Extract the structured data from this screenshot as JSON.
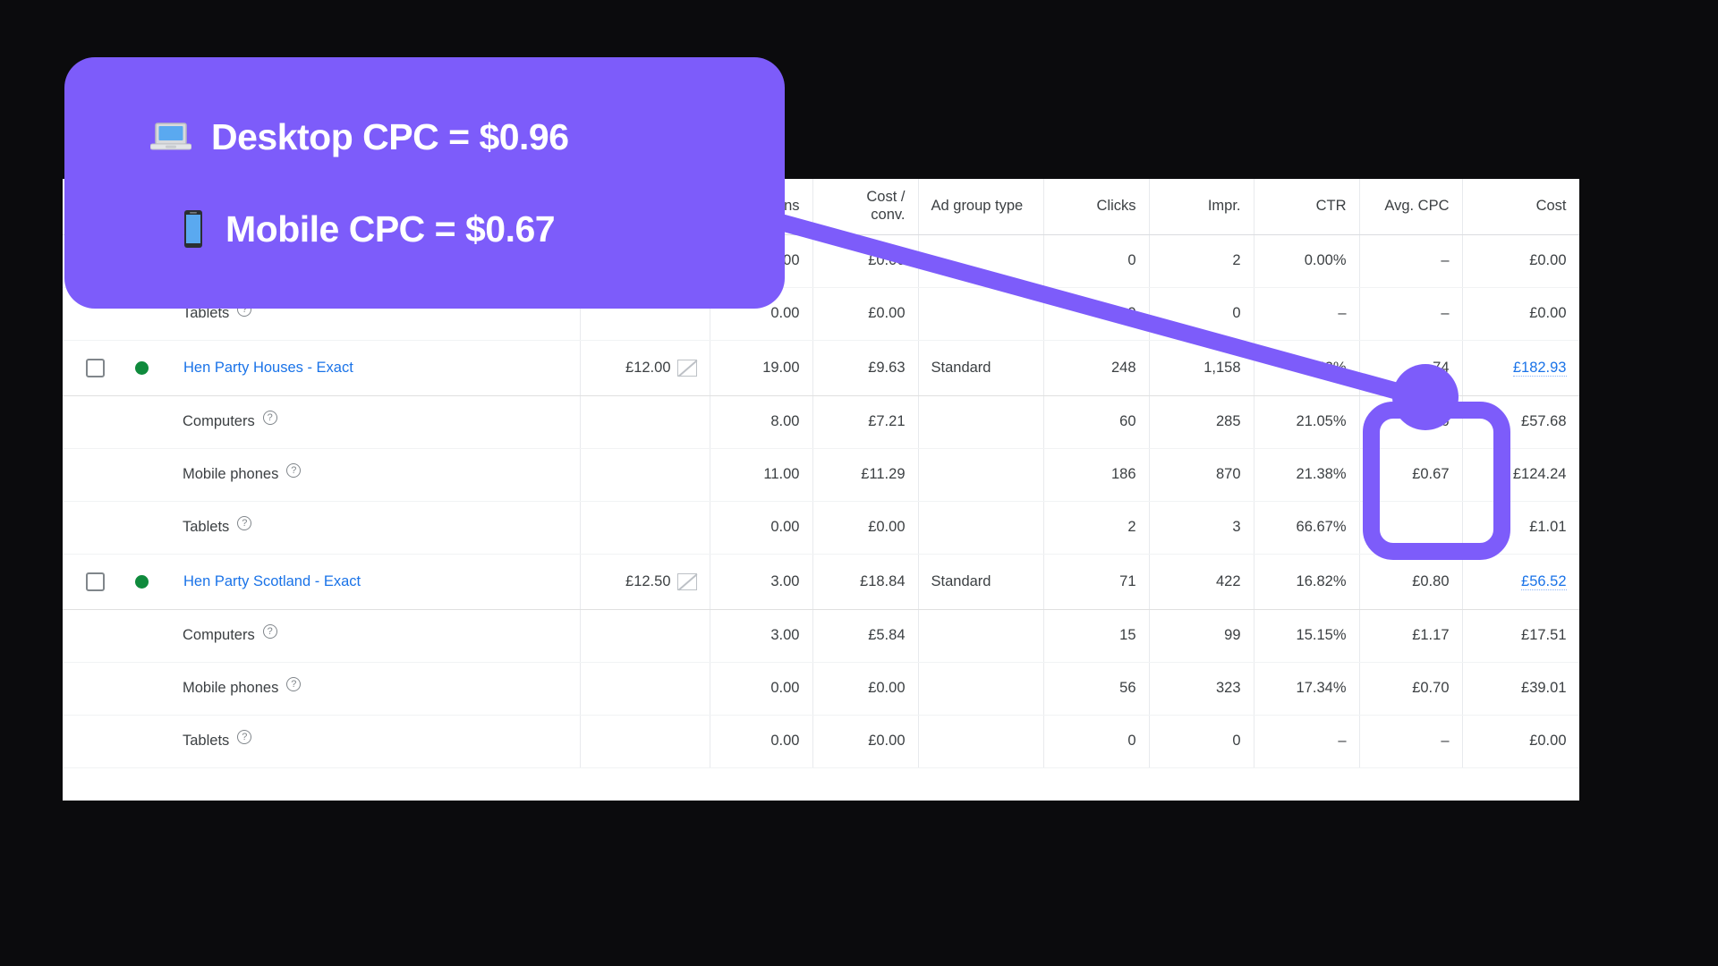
{
  "callout": {
    "lines": [
      {
        "icon": "laptop-icon",
        "glyph": "💻",
        "text": "Desktop CPC = $0.96"
      },
      {
        "icon": "mobile-phone-icon",
        "glyph": "📱",
        "text": "Mobile CPC = $0.67"
      }
    ],
    "accent_color": "#7d5cfa",
    "highlighted_values": [
      "£0.96",
      "£0.67"
    ]
  },
  "table": {
    "columns": [
      {
        "key": "name",
        "label": ""
      },
      {
        "key": "bid",
        "label": ""
      },
      {
        "key": "conv",
        "label": "ons"
      },
      {
        "key": "cost_conv",
        "label": "Cost /\nconv."
      },
      {
        "key": "ad_group_type",
        "label": "Ad group type"
      },
      {
        "key": "clicks",
        "label": "Clicks"
      },
      {
        "key": "impr",
        "label": "Impr."
      },
      {
        "key": "ctr",
        "label": "CTR"
      },
      {
        "key": "avg_cpc",
        "label": "Avg. CPC"
      },
      {
        "key": "cost",
        "label": "Cost"
      }
    ],
    "header": {
      "conv": "ons",
      "cost_conv_l1": "Cost /",
      "cost_conv_l2": "conv.",
      "ad_group_type": "Ad group type",
      "clicks": "Clicks",
      "impr": "Impr.",
      "ctr": "CTR",
      "avg_cpc": "Avg. CPC",
      "cost": "Cost"
    },
    "rows": [
      {
        "type": "sub",
        "device": "",
        "conv": ".00",
        "cost_conv": "£0.00",
        "ad_group_type": "",
        "clicks": "0",
        "impr": "2",
        "ctr": "0.00%",
        "avg_cpc": "–",
        "cost": "£0.00"
      },
      {
        "type": "sub",
        "device": "Tablets",
        "conv": "0.00",
        "cost_conv": "£0.00",
        "ad_group_type": "",
        "clicks": "0",
        "impr": "0",
        "ctr": "–",
        "avg_cpc": "–",
        "cost": "£0.00"
      },
      {
        "type": "group",
        "name": "Hen Party Houses - Exact",
        "bid": "£12.00",
        "conv": "19.00",
        "cost_conv": "£9.63",
        "ad_group_type": "Standard",
        "clicks": "248",
        "impr": "1,158",
        "ctr": "21.42%",
        "avg_cpc": "74",
        "cost": "£182.93",
        "cost_is_link": true
      },
      {
        "type": "sub",
        "device": "Computers",
        "conv": "8.00",
        "cost_conv": "£7.21",
        "ad_group_type": "",
        "clicks": "60",
        "impr": "285",
        "ctr": "21.05%",
        "avg_cpc": "£0.96",
        "cost": "£57.68"
      },
      {
        "type": "sub",
        "device": "Mobile phones",
        "conv": "11.00",
        "cost_conv": "£11.29",
        "ad_group_type": "",
        "clicks": "186",
        "impr": "870",
        "ctr": "21.38%",
        "avg_cpc": "£0.67",
        "cost": "£124.24"
      },
      {
        "type": "sub",
        "device": "Tablets",
        "conv": "0.00",
        "cost_conv": "£0.00",
        "ad_group_type": "",
        "clicks": "2",
        "impr": "3",
        "ctr": "66.67%",
        "avg_cpc": "",
        "cost": "£1.01"
      },
      {
        "type": "group",
        "name": "Hen Party Scotland - Exact",
        "bid": "£12.50",
        "conv": "3.00",
        "cost_conv": "£18.84",
        "ad_group_type": "Standard",
        "clicks": "71",
        "impr": "422",
        "ctr": "16.82%",
        "avg_cpc": "£0.80",
        "cost": "£56.52",
        "cost_is_link": true
      },
      {
        "type": "sub",
        "device": "Computers",
        "conv": "3.00",
        "cost_conv": "£5.84",
        "ad_group_type": "",
        "clicks": "15",
        "impr": "99",
        "ctr": "15.15%",
        "avg_cpc": "£1.17",
        "cost": "£17.51"
      },
      {
        "type": "sub",
        "device": "Mobile phones",
        "conv": "0.00",
        "cost_conv": "£0.00",
        "ad_group_type": "",
        "clicks": "56",
        "impr": "323",
        "ctr": "17.34%",
        "avg_cpc": "£0.70",
        "cost": "£39.01"
      },
      {
        "type": "sub",
        "device": "Tablets",
        "conv": "0.00",
        "cost_conv": "£0.00",
        "ad_group_type": "",
        "clicks": "0",
        "impr": "0",
        "ctr": "–",
        "avg_cpc": "–",
        "cost": "£0.00"
      }
    ],
    "help_glyph": "?",
    "status_color": "#0f8a3c",
    "link_color": "#1a73e8"
  }
}
